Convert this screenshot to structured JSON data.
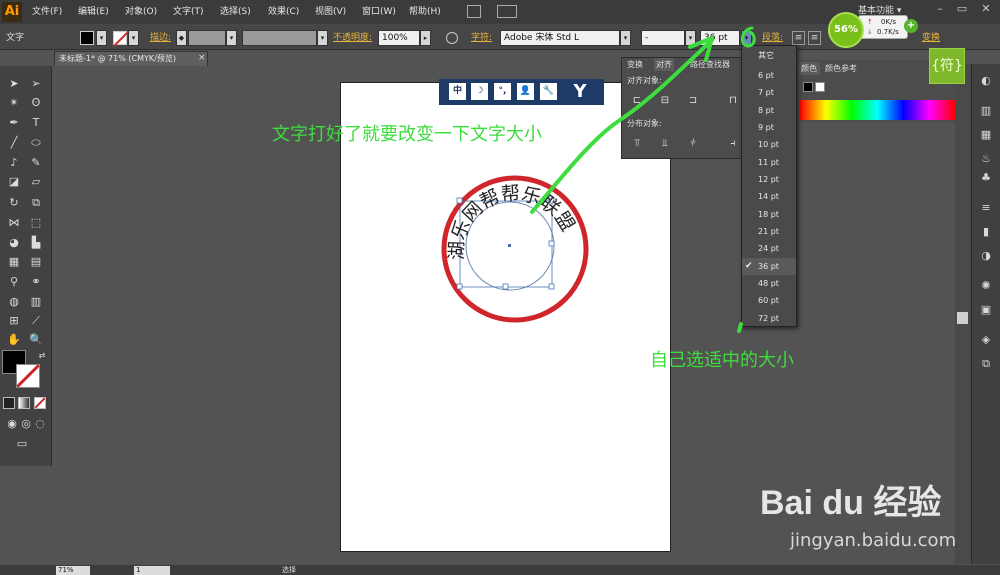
{
  "menus": [
    "文件(F)",
    "编辑(E)",
    "对象(O)",
    "文字(T)",
    "选择(S)",
    "效果(C)",
    "视图(V)",
    "窗口(W)",
    "帮助(H)"
  ],
  "app_logo": "Ai",
  "workspace": "基本功能 ▾",
  "control_bar": {
    "tool_name": "文字",
    "stroke_label": "描边:",
    "opacity_label": "不透明度:",
    "opacity_value": "100%",
    "char_label": "字符:",
    "font_value": "Adobe 宋体 Std L",
    "style_value": "-",
    "size_value": "36 pt",
    "paragraph_label": "段落:",
    "transform_label": "变换"
  },
  "doc_tab": {
    "title": "未标题-1* @ 71% (CMYK/预览)",
    "close": "×"
  },
  "align_panel": {
    "tabs": [
      "变换",
      "对齐",
      "路径查找器"
    ],
    "align_objects": "对齐对象:",
    "distribute_objects": "分布对象:"
  },
  "color_panel": {
    "tabs": [
      "颜色",
      "颜色参考"
    ]
  },
  "font_sizes": {
    "header": "其它",
    "items": [
      "6 pt",
      "7 pt",
      "8 pt",
      "9 pt",
      "10 pt",
      "11 pt",
      "12 pt",
      "14 pt",
      "18 pt",
      "21 pt",
      "24 pt",
      "36 pt",
      "48 pt",
      "60 pt",
      "72 pt"
    ],
    "selected": "36 pt"
  },
  "floating_toolbar": [
    "中",
    "☽",
    "°,",
    "👤",
    "🔧",
    "Y"
  ],
  "seal_text": "湖乐网帮帮乐联盟",
  "annotations": {
    "top": "文字打好了就要改变一下文字大小",
    "bottom": "自己选适中的大小"
  },
  "net_widget": {
    "percent": "56%",
    "up": "0K/s",
    "down": "0.7K/s"
  },
  "side_button": "{符}",
  "bottom_bar": {
    "zoom": "71%",
    "page": "1",
    "status": "选择"
  },
  "watermark": {
    "logo_text": "Bai du 经验",
    "url": "jingyan.baidu.com"
  },
  "colors": {
    "seal_red": "#d0262b",
    "annotation_green": "#3ddd3d"
  }
}
